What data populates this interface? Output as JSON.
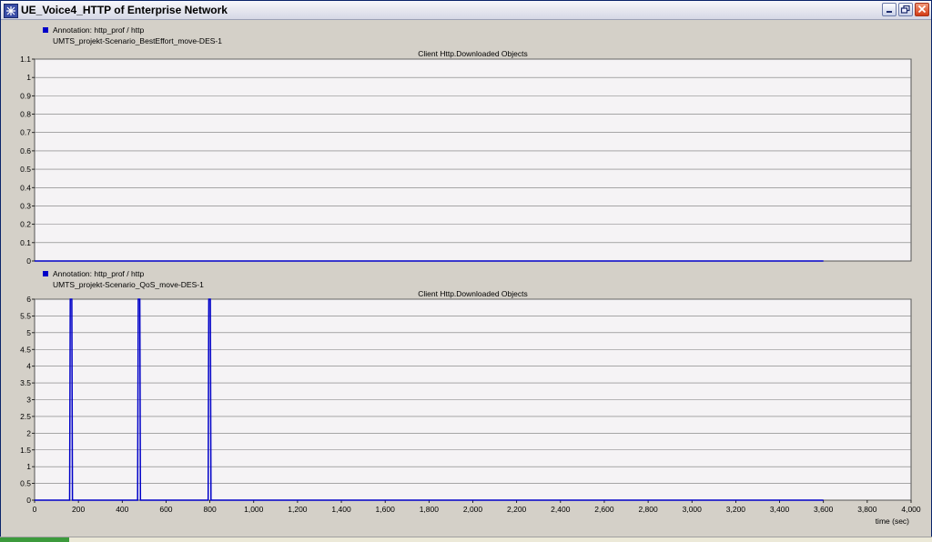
{
  "window": {
    "title": "UE_Voice4_HTTP of Enterprise Network",
    "icon": "network-app-icon"
  },
  "controls": {
    "minimize_icon": "minimize-icon",
    "maximize_icon": "restore-icon",
    "close_icon": "close-icon"
  },
  "colors": {
    "series": "#0000c8",
    "plot_bg": "#f5f3f5",
    "panel_bg": "#d4d0c8",
    "grid": "#777777"
  },
  "chart_data": [
    {
      "type": "line",
      "title": "Client Http.Downloaded Objects",
      "legend": {
        "annotation": "Annotation: http_prof / http",
        "scenario": "UMTS_projekt-Scenario_BestEffort_move-DES-1",
        "position": "top-left"
      },
      "ylim": [
        0,
        1.1
      ],
      "y_ticks": [
        "0",
        "0.1",
        "0.2",
        "0.3",
        "0.4",
        "0.5",
        "0.6",
        "0.7",
        "0.8",
        "0.9",
        "1",
        "1.1"
      ],
      "grid": true,
      "series": [
        {
          "points": [
            [
              0,
              0
            ],
            [
              3600,
              0
            ]
          ]
        }
      ]
    },
    {
      "type": "line",
      "title": "Client Http.Downloaded Objects",
      "legend": {
        "annotation": "Annotation: http_prof / http",
        "scenario": "UMTS_projekt-Scenario_QoS_move-DES-1",
        "position": "top-left"
      },
      "ylim": [
        0,
        6
      ],
      "y_ticks": [
        "0",
        "0.5",
        "1",
        "1.5",
        "2",
        "2.5",
        "3",
        "3.5",
        "4",
        "4.5",
        "5",
        "5.5",
        "6"
      ],
      "xlim": [
        0,
        4000
      ],
      "x_ticks": [
        "0",
        "200",
        "400",
        "600",
        "800",
        "1,000",
        "1,200",
        "1,400",
        "1,600",
        "1,800",
        "2,000",
        "2,200",
        "2,400",
        "2,600",
        "2,800",
        "3,000",
        "3,200",
        "3,400",
        "3,600",
        "3,800",
        "4,000"
      ],
      "xlabel": "time (sec)",
      "grid": true,
      "series": [
        {
          "points": [
            [
              0,
              0
            ],
            [
              160,
              0
            ],
            [
              163,
              6
            ],
            [
              170,
              6
            ],
            [
              173,
              0
            ],
            [
              470,
              0
            ],
            [
              473,
              6
            ],
            [
              480,
              6
            ],
            [
              483,
              0
            ],
            [
              792,
              0
            ],
            [
              795,
              6
            ],
            [
              802,
              6
            ],
            [
              805,
              0
            ],
            [
              3600,
              0
            ]
          ]
        }
      ]
    }
  ]
}
